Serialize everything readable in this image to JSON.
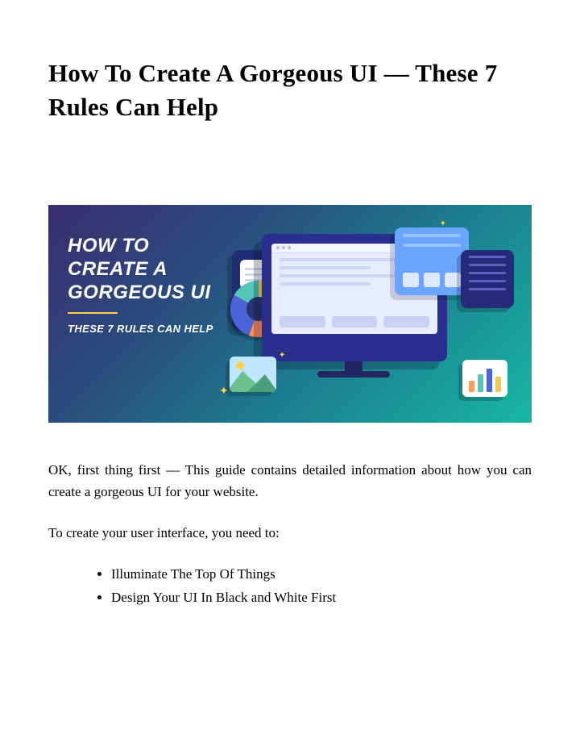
{
  "title": "How To Create A Gorgeous UI — These 7 Rules Can Help",
  "hero": {
    "title": "HOW TO CREATE A GORGEOUS UI",
    "subtitle": "THESE 7 RULES CAN HELP"
  },
  "para1": "OK, first thing first — This guide contains detailed information about how you can create a gorgeous UI for your website.",
  "para2": "To create your user interface, you need to:",
  "bullets": [
    "Illuminate The Top Of Things",
    "Design Your UI In Black and White First"
  ]
}
